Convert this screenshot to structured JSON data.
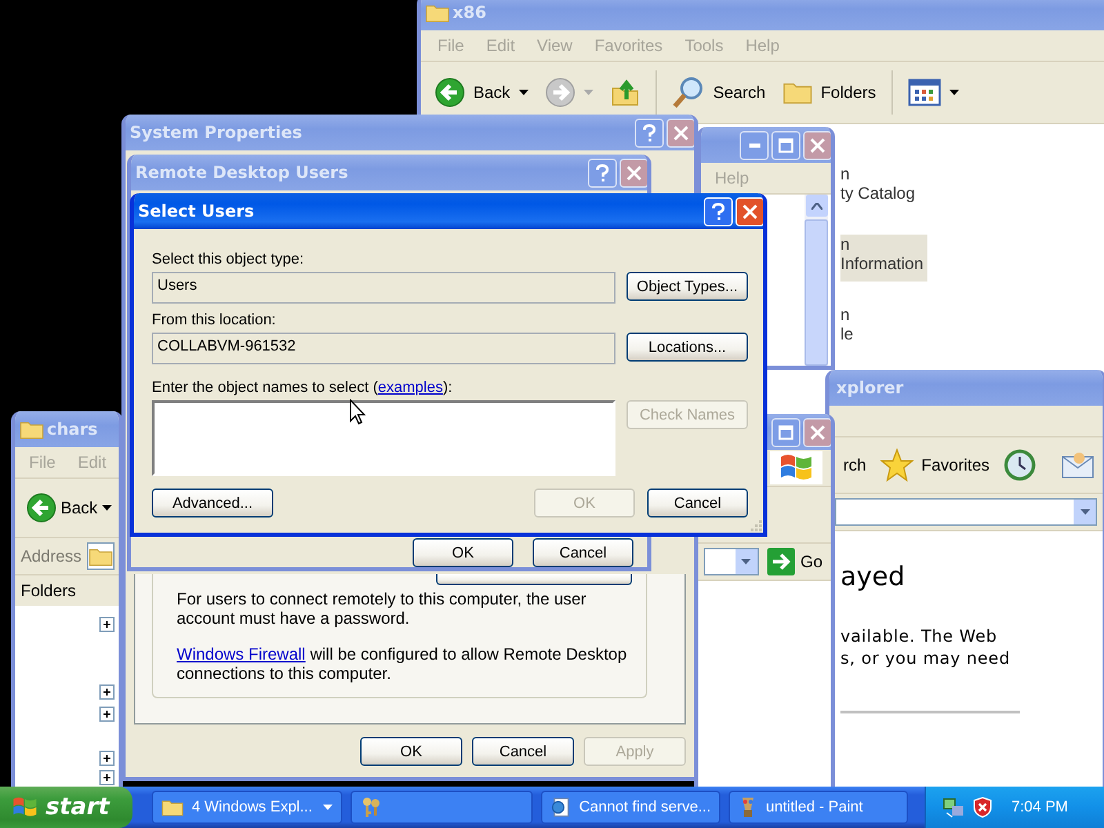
{
  "x86_window": {
    "title": "x86",
    "active": false,
    "menu": [
      "File",
      "Edit",
      "View",
      "Favorites",
      "Tools",
      "Help"
    ],
    "toolbar": [
      {
        "kind": "back",
        "label": "Back"
      },
      {
        "kind": "forward"
      },
      {
        "kind": "up"
      },
      {
        "kind": "search",
        "label": "Search"
      },
      {
        "kind": "folders",
        "label": "Folders"
      },
      {
        "kind": "views"
      }
    ],
    "items": [
      {
        "line_1": "n",
        "line_2": "ty Catalog",
        "selected": false
      },
      {
        "line_1": "n",
        "line_2": "Information",
        "selected": true
      },
      {
        "line_1": "n",
        "line_2": "le",
        "selected": false
      }
    ]
  },
  "help_window": {
    "active": false,
    "menu": [
      "Help"
    ]
  },
  "ie_window": {
    "title": "xplorer",
    "active": false,
    "toolbar": [
      {
        "kind": "text",
        "label": "rch"
      },
      {
        "kind": "favorites",
        "label": "Favorites"
      },
      {
        "kind": "history"
      },
      {
        "kind": "mail"
      }
    ],
    "heading": "ayed",
    "lines": [
      "vailable. The Web",
      "s, or you may need"
    ]
  },
  "go_window": {
    "active": false,
    "go_label": "Go"
  },
  "chars_window": {
    "title": "chars",
    "active": false,
    "menu": [
      "File",
      "Edit"
    ],
    "back_label": "Back",
    "address_label": "Address",
    "folders_label": "Folders",
    "tree": [
      {
        "expanded": false
      },
      {
        "expanded": false
      },
      {
        "expanded": false
      },
      {
        "expanded": false
      },
      {
        "expanded": false
      }
    ]
  },
  "system_properties": {
    "title": "System Properties",
    "active": false,
    "note": "For users to connect remotely to this computer, the user account must have a password.",
    "firewall_link": "Windows Firewall",
    "firewall_text": " will be configured to allow Remote Desktop connections to this computer.",
    "buttons": [
      {
        "label": "OK",
        "disabled": false
      },
      {
        "label": "Cancel",
        "disabled": false
      },
      {
        "label": "Apply",
        "disabled": true
      }
    ]
  },
  "remote_desktop_users": {
    "title": "Remote Desktop Users",
    "active": false,
    "buttons": [
      {
        "label": "OK",
        "disabled": false
      },
      {
        "label": "Cancel",
        "disabled": false
      }
    ]
  },
  "select_users": {
    "title": "Select Users",
    "active": true,
    "object_type_label": "Select this object type:",
    "object_type": "Users",
    "object_types_button": "Object Types...",
    "location_label": "From this location:",
    "location": "COLLABVM-961532",
    "locations_button": "Locations...",
    "names_label": "Enter the object names to select (",
    "names_link": "examples",
    "names_label_end": "):",
    "check_names": {
      "label": "Check Names",
      "disabled": true
    },
    "advanced_button": "Advanced...",
    "buttons": [
      {
        "label": "OK",
        "disabled": true
      },
      {
        "label": "Cancel",
        "disabled": false
      }
    ]
  },
  "taskbar": {
    "start": "start",
    "tasks": [
      {
        "kind": "explorer",
        "label": "4 Windows Expl...",
        "selected": false
      },
      {
        "kind": "keys",
        "selected": false
      },
      {
        "kind": "ie",
        "label": "Cannot find serve...",
        "selected": false
      },
      {
        "kind": "paint",
        "label": "untitled - Paint",
        "selected": false
      }
    ],
    "clock": "7:04 PM"
  }
}
